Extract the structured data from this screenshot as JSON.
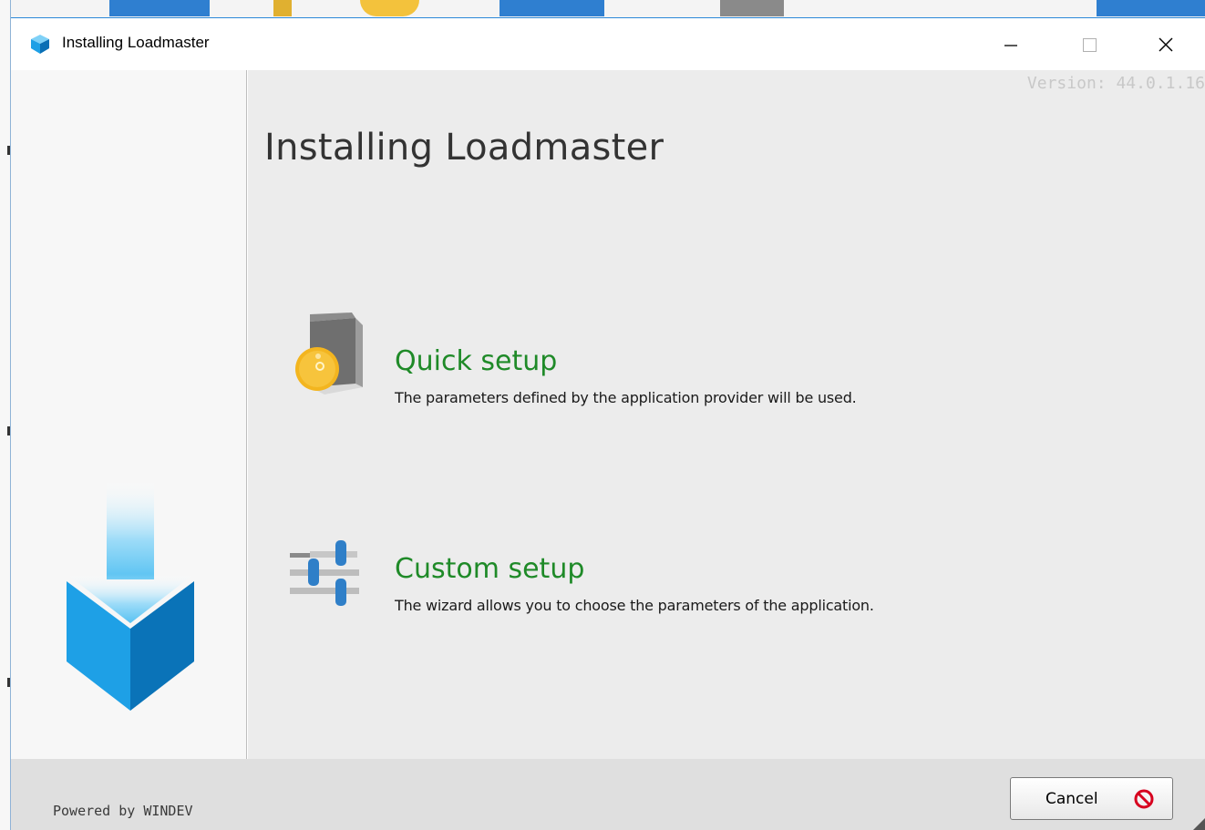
{
  "window": {
    "title": "Installing Loadmaster",
    "controls": {
      "minimize": "minimize",
      "maximize": "maximize",
      "close": "close"
    }
  },
  "main": {
    "version": "Version: 44.0.1.16",
    "heading": "Installing Loadmaster",
    "options": [
      {
        "title": "Quick setup",
        "description": "The parameters defined by the application provider will be used.",
        "icon": "package-disc-icon"
      },
      {
        "title": "Custom setup",
        "description": "The wizard allows you to choose the parameters of the application.",
        "icon": "sliders-icon"
      }
    ]
  },
  "footer": {
    "powered_by": "Powered by WINDEV",
    "cancel_label": "Cancel"
  },
  "colors": {
    "accent_green": "#1f8a28",
    "brand_blue": "#1ea0e6",
    "cancel_red": "#d7001f"
  }
}
